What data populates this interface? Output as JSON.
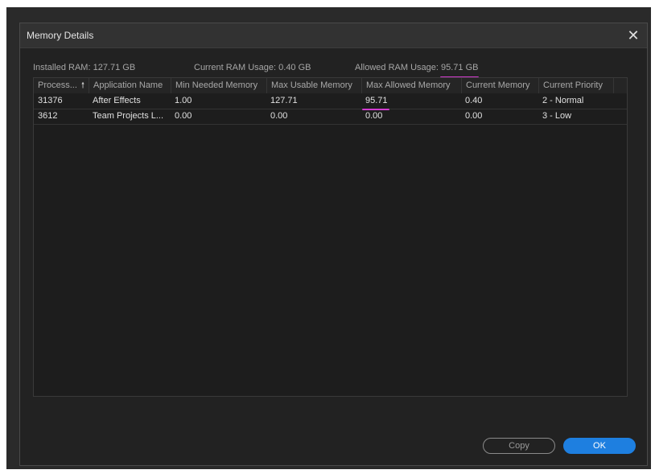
{
  "dialog": {
    "title": "Memory Details",
    "close_glyph": "✕"
  },
  "stats": {
    "installed": "Installed RAM: 127.71 GB",
    "current": "Current RAM Usage: 0.40 GB",
    "allowed": "Allowed RAM Usage: 95.71 GB"
  },
  "table": {
    "columns": [
      "Process...",
      "Application Name",
      "Min Needed Memory",
      "Max Usable Memory",
      "Max Allowed Memory",
      "Current Memory",
      "Current Priority"
    ],
    "sort_glyph": "🠕",
    "rows": [
      {
        "process": "31376",
        "app": "After Effects",
        "min": "1.00",
        "max_usable": "127.71",
        "max_allowed": "95.71",
        "current": "0.40",
        "priority": "2 - Normal"
      },
      {
        "process": "3612",
        "app": "Team Projects L...",
        "min": "0.00",
        "max_usable": "0.00",
        "max_allowed": "0.00",
        "current": "0.00",
        "priority": "3 - Low"
      }
    ]
  },
  "buttons": {
    "copy": "Copy",
    "ok": "OK"
  },
  "colors": {
    "accent": "#1e7fe0",
    "annotation": "#d23bd0"
  }
}
